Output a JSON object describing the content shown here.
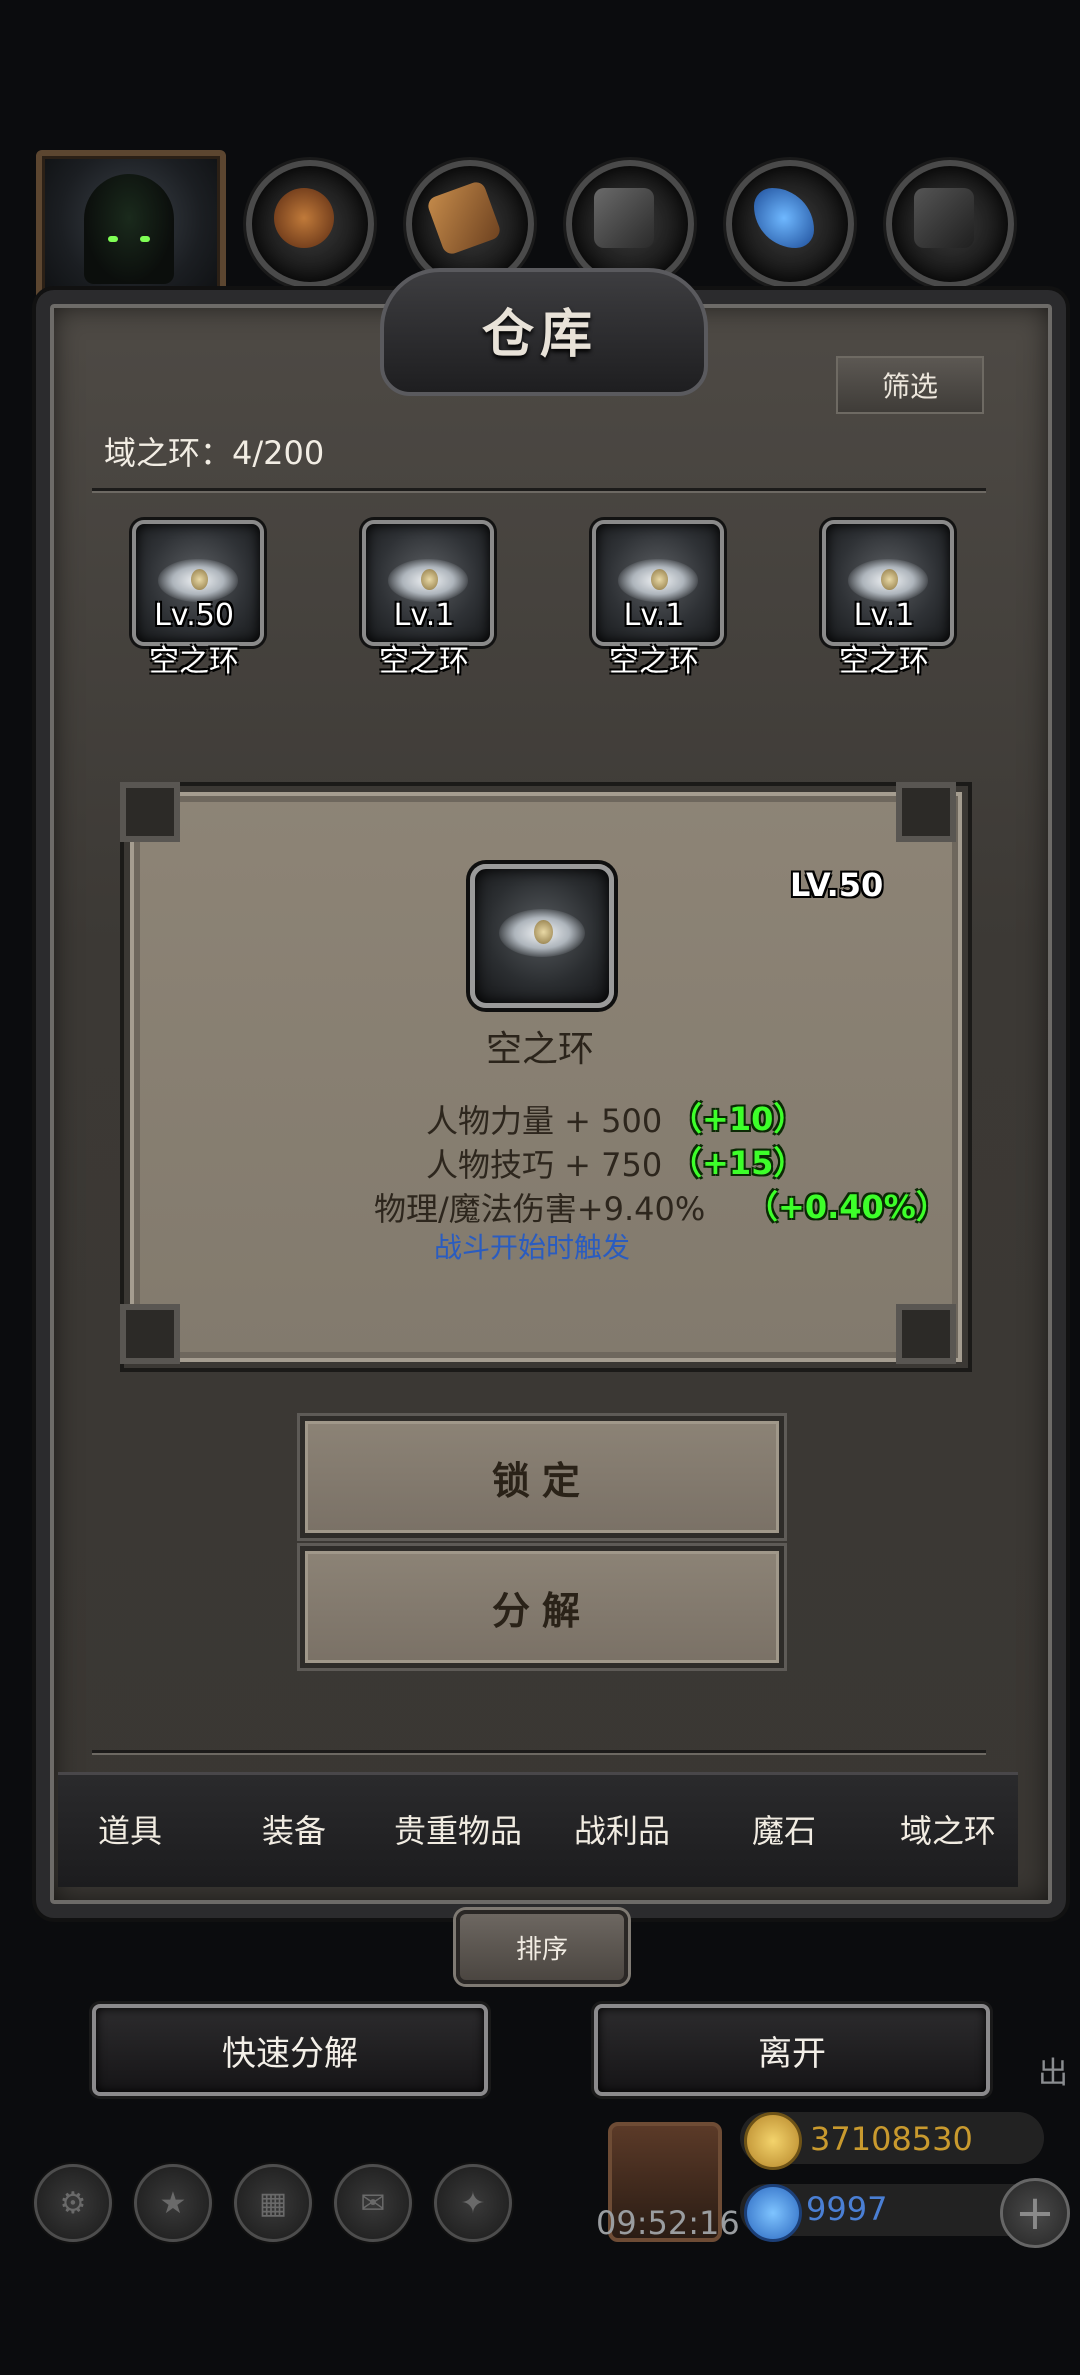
{
  "window": {
    "title": "仓库"
  },
  "header": {
    "filter_label": "筛选"
  },
  "inventory": {
    "count_label": "域之环：4/200",
    "items": [
      {
        "level": "Lv.50",
        "name": "空之环"
      },
      {
        "level": "Lv.1",
        "name": "空之环"
      },
      {
        "level": "Lv.1",
        "name": "空之环"
      },
      {
        "level": "Lv.1",
        "name": "空之环"
      }
    ]
  },
  "detail": {
    "level": "LV.50",
    "name": "空之环",
    "stats": [
      {
        "label": "人物力量 + 500",
        "bonus": "（+10）"
      },
      {
        "label": "人物技巧 + 750",
        "bonus": "（+15）"
      },
      {
        "label": "物理/魔法伤害+9.40%",
        "bonus": "（+0.40%）"
      }
    ],
    "trigger": "战斗开始时触发"
  },
  "actions": {
    "lock_label": "锁定",
    "decompose_label": "分解"
  },
  "tabs": [
    "道具",
    "装备",
    "贵重物品",
    "战利品",
    "魔石",
    "域之环"
  ],
  "sort_label": "排序",
  "bottom": {
    "quick_decompose_label": "快速分解",
    "leave_label": "离开"
  },
  "hud": {
    "clock": "09:52:16",
    "gold": "37108530",
    "gems": "9997",
    "side_glyph": "出"
  },
  "colors": {
    "bonus_green": "#3dff2a",
    "trigger_blue": "#2a5cc0",
    "gold_text": "#c99a2e",
    "gem_text": "#4a7fd4"
  }
}
